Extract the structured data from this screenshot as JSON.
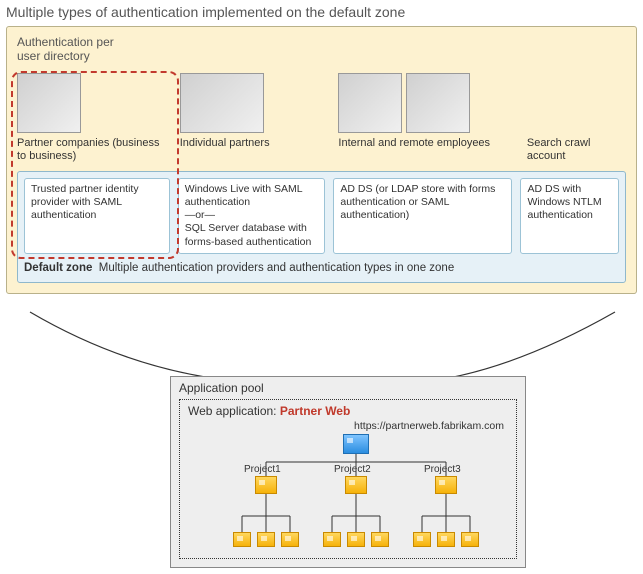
{
  "title": "Multiple types of authentication implemented on the default zone",
  "auth_per_directory_label": "Authentication per\nuser directory",
  "columns": {
    "partner_companies": {
      "label": "Partner companies (business to business)",
      "auth": "Trusted partner identity provider with SAML authentication"
    },
    "individual_partners": {
      "label": "Individual partners",
      "auth": "Windows Live with SAML authentication\n—or—\nSQL Server database with forms-based authentication"
    },
    "internal_remote": {
      "label": "Internal and remote employees",
      "auth": "AD DS  (or LDAP store with forms authentication or SAML authentication)"
    },
    "search_crawl": {
      "label": "Search crawl account",
      "auth": "AD DS with Windows NTLM authentication"
    }
  },
  "zone": {
    "name": "Default zone",
    "description": "Multiple authentication providers and authentication types in one zone"
  },
  "app_pool": {
    "label": "Application pool",
    "web_app_label": "Web application:",
    "web_app_name": "Partner Web",
    "url": "https://partnerweb.fabrikam.com",
    "projects": [
      "Project1",
      "Project2",
      "Project3"
    ]
  }
}
